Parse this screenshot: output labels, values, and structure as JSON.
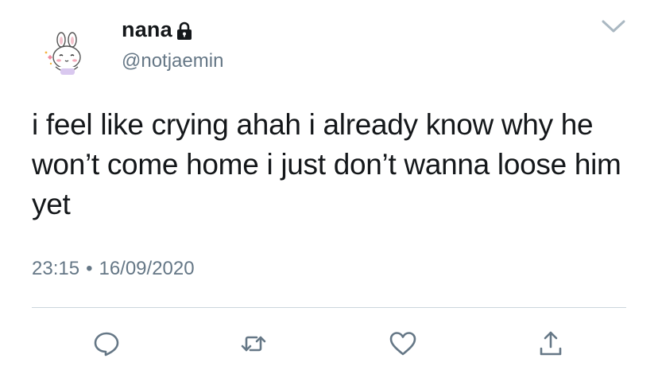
{
  "user": {
    "display_name": "nana",
    "handle": "@notjaemin",
    "avatar_icon": "bunny-avatar-icon",
    "protected_icon": "lock-icon"
  },
  "tweet": {
    "text": "i feel like crying ahah i already know why he won’t come home i just don’t wanna loose him yet",
    "time": "23:15",
    "separator": "•",
    "date": "16/09/2020"
  },
  "actions": {
    "reply_icon": "reply-icon",
    "retweet_icon": "retweet-icon",
    "like_icon": "heart-icon",
    "share_icon": "share-icon",
    "menu_icon": "chevron-down-icon"
  },
  "colors": {
    "text_primary": "#14171a",
    "text_secondary": "#657786",
    "action_icon": "#657786",
    "divider": "#ccd6dd"
  }
}
